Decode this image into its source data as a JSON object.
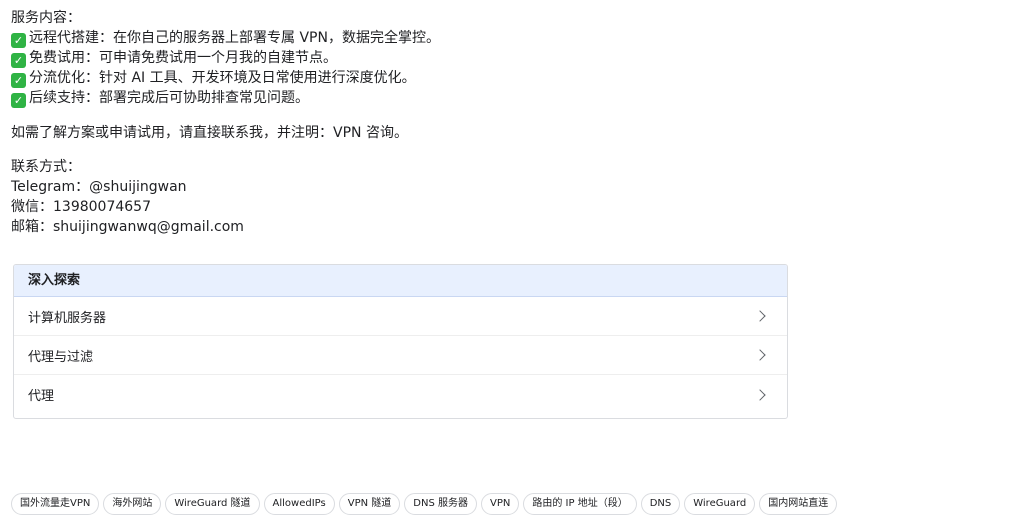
{
  "content": {
    "services_title": "服务内容：",
    "services": [
      {
        "icon": "check-mark-icon",
        "text": "远程代搭建：在你自己的服务器上部署专属 VPN，数据完全掌控。"
      },
      {
        "icon": "check-mark-icon",
        "text": "免费试用：可申请免费试用一个月我的自建节点。"
      },
      {
        "icon": "check-mark-icon",
        "text": "分流优化：针对 AI 工具、开发环境及日常使用进行深度优化。"
      },
      {
        "icon": "check-mark-icon",
        "text": "后续支持：部署完成后可协助排查常见问题。"
      }
    ],
    "cta": "如需了解方案或申请试用，请直接联系我，并注明：VPN 咨询。",
    "contact_title": "联系方式：",
    "contacts": [
      "Telegram：@shuijingwan",
      "微信：13980074657",
      "邮箱：shuijingwanwq@gmail.com"
    ]
  },
  "explore": {
    "header": "深入探索",
    "items": [
      "计算机服务器",
      "代理与过滤",
      "代理"
    ]
  },
  "tags": [
    "国外流量走VPN",
    "海外网站",
    "WireGuard 隧道",
    "AllowedIPs",
    "VPN 隧道",
    "DNS 服务器",
    "VPN",
    "路由的 IP 地址（段）",
    "DNS",
    "WireGuard",
    "国内网站直连"
  ],
  "colors": {
    "check": "#2fb344",
    "explore_header_bg": "#e8f0fe"
  }
}
